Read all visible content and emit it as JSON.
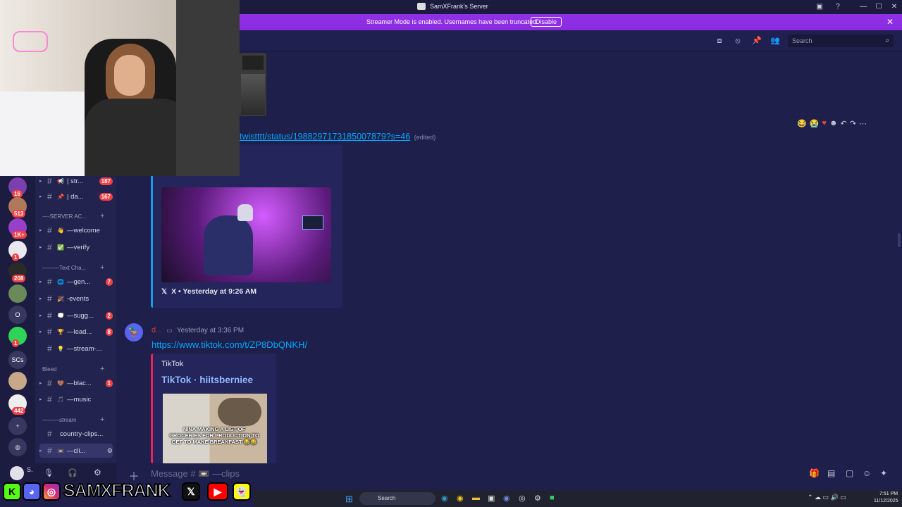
{
  "window": {
    "title": "SamXFrank's Server"
  },
  "streamer_banner": {
    "message": "Streamer Mode is enabled. Usernames have been truncated.",
    "disable_label": "Disable"
  },
  "header": {
    "search_placeholder": "Search"
  },
  "servers": [
    {
      "badge": "16",
      "color": "#7b3fb0"
    },
    {
      "badge": "513",
      "color": "#b07a5a"
    },
    {
      "badge": "1K+",
      "color": "#9a3fc8"
    },
    {
      "badge": "1",
      "color": "#e8e8ee"
    },
    {
      "badge": "208",
      "color": "#2a2a2a"
    },
    {
      "badge": "",
      "color": "#6a8a5a"
    },
    {
      "label": "O",
      "color": "#36385f"
    },
    {
      "badge": "1",
      "color": "#2fd35a"
    },
    {
      "label": "SCs",
      "color": "#36385f"
    },
    {
      "badge": "",
      "color": "#c8a888"
    },
    {
      "badge": "442",
      "color": "#eeeeee"
    }
  ],
  "channels": {
    "items": [
      {
        "name": "| str...",
        "emoji": "📢",
        "count": "187"
      },
      {
        "name": "| da...",
        "emoji": "📌",
        "count": "167"
      },
      {
        "name": "—welcome",
        "emoji": "👋",
        "count": ""
      },
      {
        "name": "—verify",
        "emoji": "✅",
        "count": ""
      },
      {
        "name": "—gen...",
        "emoji": "🌐",
        "count": "7"
      },
      {
        "name": "-events",
        "emoji": "🎉",
        "count": ""
      },
      {
        "name": "—sugg...",
        "emoji": "💭",
        "count": "2"
      },
      {
        "name": "—lead...",
        "emoji": "🏆",
        "count": "8"
      },
      {
        "name": "—stream-...",
        "emoji": "💡",
        "count": ""
      },
      {
        "name": "—blac...",
        "emoji": "🤎",
        "count": "1"
      },
      {
        "name": "—music",
        "emoji": "🎵",
        "count": ""
      },
      {
        "name": "country-clips...",
        "emoji": "",
        "count": ""
      },
      {
        "name": "—cli...",
        "emoji": "📼",
        "count": ""
      }
    ],
    "categories": [
      "----SERVER AC...",
      "———Text Cha...",
      "Bleed",
      "———stream"
    ]
  },
  "messages": {
    "link1": "twistttt/status/1988297173185007879?s=46",
    "edited": "(edited)",
    "embed1_footer": "X • Yesterday at 9:26 AM",
    "author2": "d...",
    "timestamp2": "Yesterday at 3:36 PM",
    "link2": "https://www.tiktok.com/t/ZP8DbQNKH/",
    "embed2_provider": "TikTok",
    "embed2_title": "TikTok · hiitsberniee",
    "embed2_caption": "NINA MAKING A LIST OF GROCERIES FOR PRODUCTION TO GET TO MAKE BREAKFAST 😂😂"
  },
  "composer": {
    "placeholder": "Message # 📼 —clips"
  },
  "overlay": {
    "name": "SAMXFRANK"
  },
  "taskbar": {
    "search": "Search",
    "time": "7:51 PM",
    "date": "11/12/2025"
  }
}
